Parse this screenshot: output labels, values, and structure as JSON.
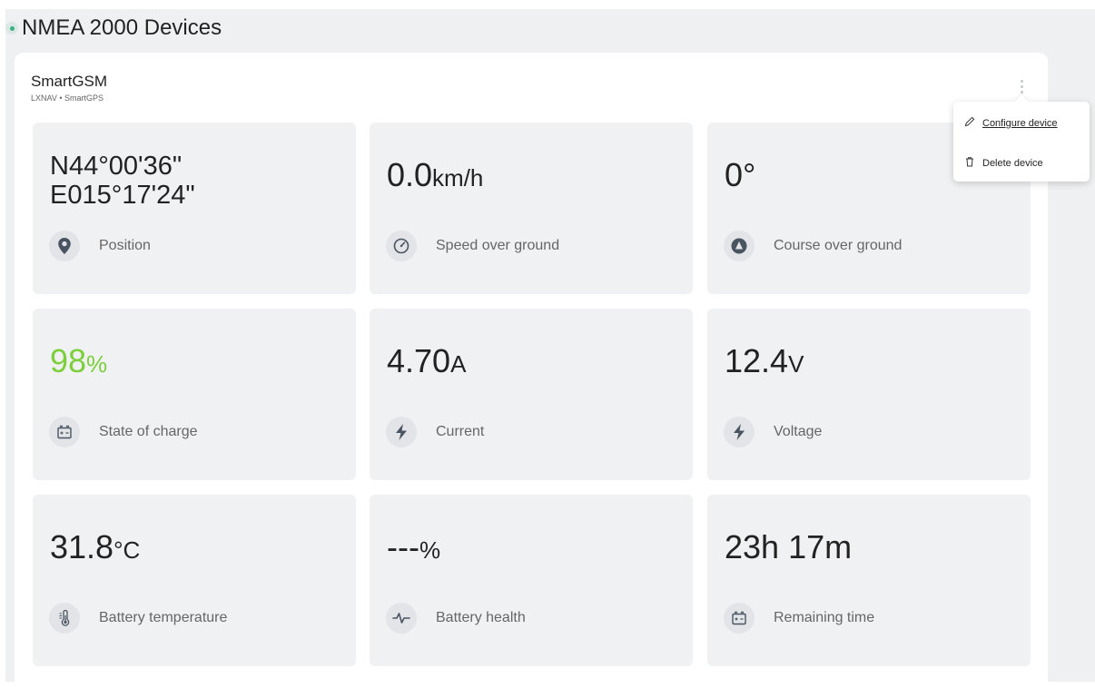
{
  "section": {
    "title": "NMEA 2000 Devices"
  },
  "device": {
    "name": "SmartGSM",
    "subtitle": "LXNAV • SmartGPS"
  },
  "menu": {
    "configure_label": "Configure device",
    "delete_label": "Delete device"
  },
  "tiles": [
    {
      "value_line1": "N44°00'36\"",
      "value_line2": "E015°17'24\"",
      "label": "Position",
      "icon": "map-pin-icon"
    },
    {
      "value": "0.0",
      "unit": "km/h",
      "label": "Speed over ground",
      "icon": "speedometer-icon"
    },
    {
      "value": "0°",
      "unit": "",
      "label": "Course over ground",
      "icon": "compass-arrow-icon"
    },
    {
      "value": "98",
      "unit": "%",
      "label": "State of charge",
      "icon": "battery-icon",
      "value_color": "#7ccf3a"
    },
    {
      "value": "4.70",
      "unit": "A",
      "label": "Current",
      "icon": "lightning-icon"
    },
    {
      "value": "12.4",
      "unit": "V",
      "label": "Voltage",
      "icon": "lightning-icon"
    },
    {
      "value": "31.8",
      "unit": "°C",
      "label": "Battery temperature",
      "icon": "thermometer-icon"
    },
    {
      "value": "---",
      "unit": "%",
      "label": "Battery health",
      "icon": "pulse-icon"
    },
    {
      "value": "23h 17m",
      "unit": "",
      "label": "Remaining time",
      "icon": "battery-icon"
    }
  ]
}
